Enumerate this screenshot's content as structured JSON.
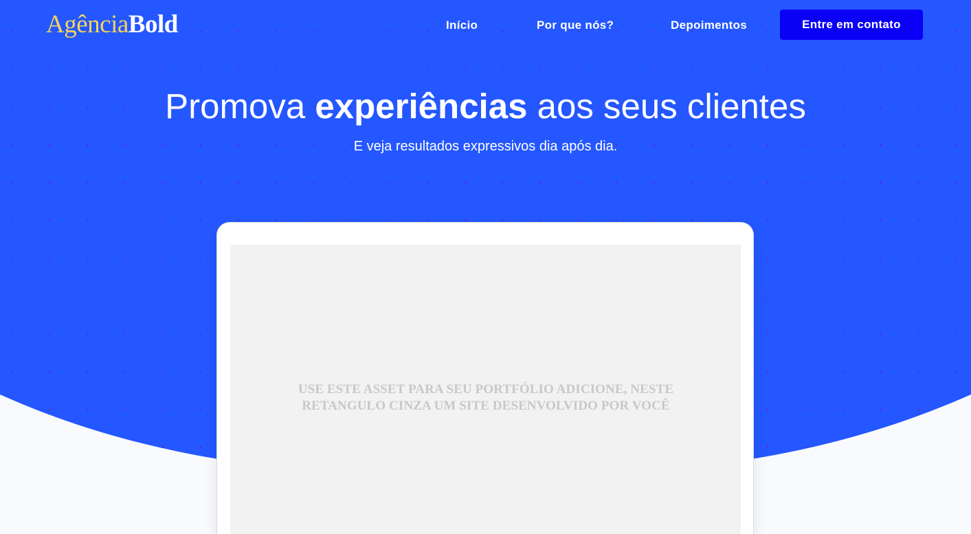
{
  "brand": {
    "logo_light": "Agência",
    "logo_bold": "Bold"
  },
  "nav": {
    "items": [
      {
        "label": "Início"
      },
      {
        "label": "Por que nós?"
      },
      {
        "label": "Depoimentos"
      }
    ],
    "cta_label": "Entre em contato"
  },
  "hero": {
    "title_prefix": "Promova ",
    "title_emphasis": "experiências",
    "title_suffix": " aos seus clientes",
    "subtitle": "E veja resultados expressivos dia após dia."
  },
  "mockup": {
    "placeholder_line_1": "USE ESTE ASSET PARA SEU PORTFÓLIO ADICIONE, NESTE",
    "placeholder_line_2": "RETANGULO CINZA UM SITE DESENVOLVIDO POR VOCÊ"
  },
  "colors": {
    "hero_blue": "#2457ff",
    "cta_blue": "#0a00f5",
    "logo_gold": "#f4d35e",
    "grid_dot": "#6a22a8",
    "screen_gray": "#f2f2f2",
    "page_background": "#f8fafd"
  }
}
